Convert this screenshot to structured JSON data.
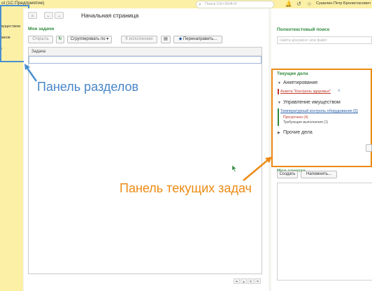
{
  "window": {
    "title": "ol (1С:Предприятие)",
    "search_placeholder": "Поиск Ctrl+Shift+F",
    "user": "Сушилин Петр Бронистасович"
  },
  "sidebar": {
    "items": [
      {
        "label": "муществом"
      },
      {
        "label": "ников"
      },
      {
        "label": "е"
      }
    ]
  },
  "main": {
    "page_title": "Начальная страница",
    "tasks": {
      "title": "Мои задачи",
      "buttons": {
        "open": "Открыть",
        "group": "Сгруппировать по",
        "to_execution": "К исполнению",
        "redirect": "Перенаправить..."
      },
      "column": "Задача"
    }
  },
  "right": {
    "fulltext": {
      "title": "Полнотекстовый поиск",
      "placeholder": "Найти документ или файл"
    },
    "current": {
      "title": "Текущие дела",
      "groups": [
        {
          "label": "Анкетирование",
          "items": [
            {
              "text": "Анкета \"Контроль здоровья\"",
              "extra": "?"
            }
          ]
        },
        {
          "label": "Управление имуществом",
          "items": [
            {
              "text": "Температурный контроль оборудования (5)"
            }
          ],
          "subitems": [
            "Просрочено (4)",
            "Требующие выполнения (1)"
          ]
        },
        {
          "label": "Прочие дела"
        }
      ]
    },
    "notes": {
      "title": "Мои заметки",
      "create": "Создать",
      "remind": "Напомнить..."
    }
  },
  "annotations": {
    "sections": "Панель разделов",
    "tasks": "Панель текущих задач"
  },
  "colors": {
    "accent_green": "#2f8a3c",
    "sidebar_yellow": "#fbf0a6",
    "sections_box": "#4a8fd0",
    "tasks_box": "#ec8a13",
    "link_red": "#c0392b",
    "link_blue": "#2a5ea8"
  }
}
